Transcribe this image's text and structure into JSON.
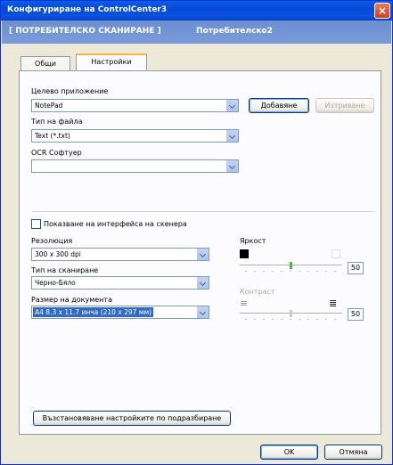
{
  "window": {
    "title": "Конфигуриране на ControlCenter3",
    "close_label": "×"
  },
  "banner": {
    "left": "[ ПОТРЕБИТЕЛСКО СКАНИРАНЕ ]",
    "right": "Потребителско2"
  },
  "tabs": [
    {
      "label": "Общи",
      "active": false
    },
    {
      "label": "Настройки",
      "active": true
    }
  ],
  "target_app": {
    "label": "Целево приложение",
    "value": "NotePad",
    "add_button": "Добавяне",
    "delete_button": "Изтриване"
  },
  "file_type": {
    "label": "Тип на файла",
    "value": "Text (*.txt)"
  },
  "ocr": {
    "label": "OCR Софтуер",
    "value": ""
  },
  "show_interface": {
    "label": "Показване на интерфейса на скенера",
    "checked": false
  },
  "resolution": {
    "label": "Резолюция",
    "value": "300 x 300 dpi"
  },
  "scan_type": {
    "label": "Тип на сканиране",
    "value": "Черно-Бяло"
  },
  "doc_size": {
    "label": "Размер на документа",
    "value": "A4 8.3 x 11.7 инча (210 x 297 мм)"
  },
  "brightness": {
    "label": "Яркост",
    "value": "50",
    "level": 0.5
  },
  "contrast": {
    "label": "Контраст",
    "value": "50",
    "level": 0.5,
    "enabled": false
  },
  "restore_button": "Възстановяване настройките по подразбиране",
  "ok_button": "OK",
  "cancel_button": "Отмяна"
}
